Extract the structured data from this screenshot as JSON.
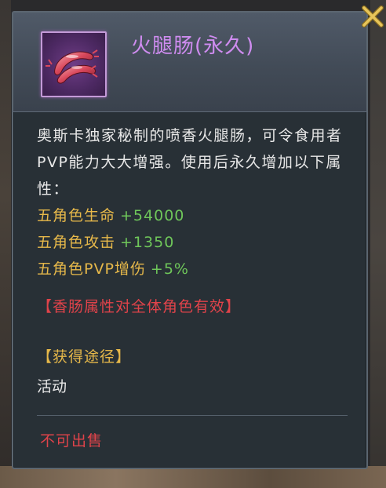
{
  "item": {
    "name": "火腿肠(永久)",
    "icon": "sausage-icon"
  },
  "description": "奥斯卡独家秘制的喷香火腿肠，可令食用者PVP能力大大增强。使用后永久增加以下属性：",
  "attributes": [
    {
      "name": "五角色生命",
      "value": "+54000"
    },
    {
      "name": "五角色攻击",
      "value": "+1350"
    },
    {
      "name": "五角色PVP增伤",
      "value": "+5%"
    }
  ],
  "note": "【香肠属性对全体角色有效】",
  "source": {
    "title": "【获得途径】",
    "value": "活动"
  },
  "sell_status": "不可出售",
  "colors": {
    "title": "#cf8cf0",
    "attr_name": "#e6b84a",
    "attr_value": "#6fc75a",
    "warning": "#e0434a",
    "text": "#e8e8e8",
    "close_icon": "#e6c45a"
  }
}
